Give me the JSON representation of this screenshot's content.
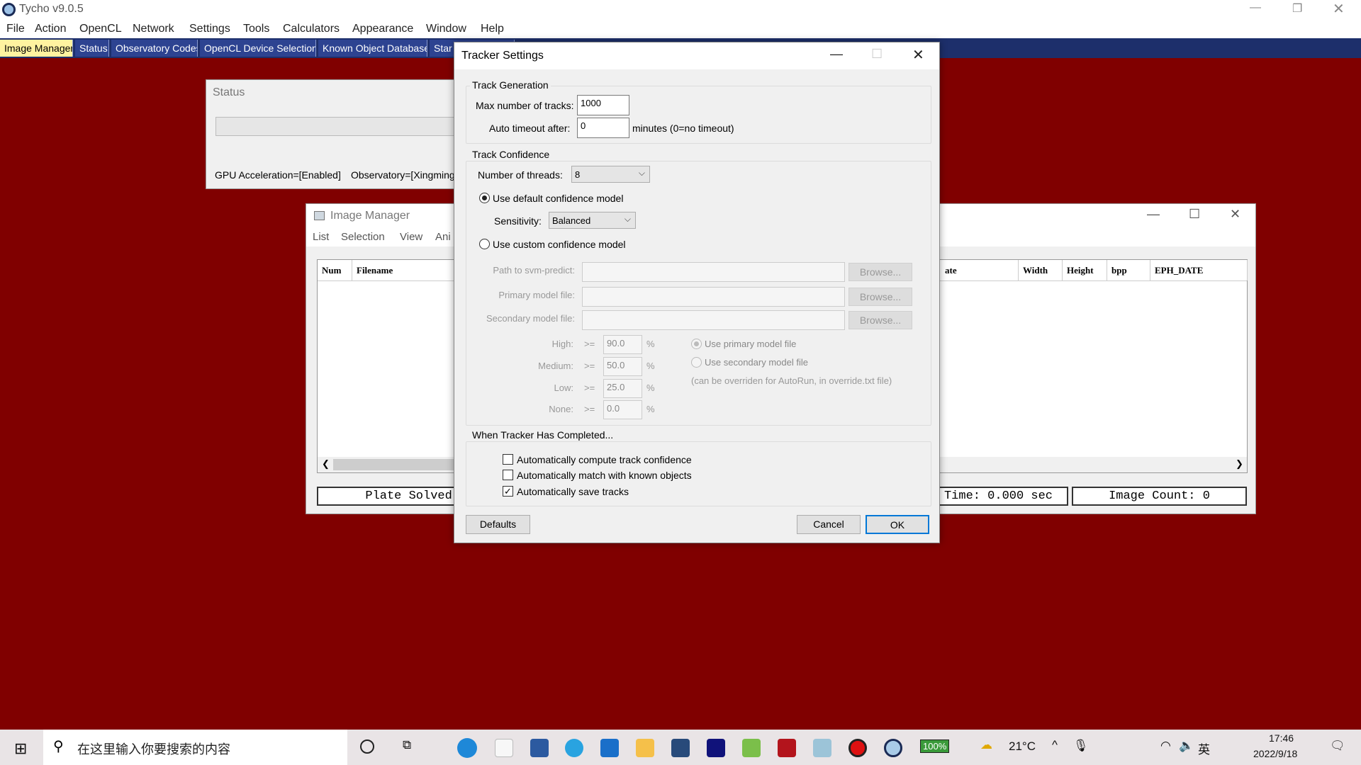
{
  "app": {
    "title": "Tycho v9.0.5"
  },
  "menu": [
    "File",
    "Action",
    "OpenCL",
    "Network",
    "Settings",
    "Tools",
    "Calculators",
    "Appearance",
    "Window",
    "Help"
  ],
  "tabs": [
    {
      "label": "Image Manager",
      "active": true
    },
    {
      "label": "Status"
    },
    {
      "label": "Observatory Codes"
    },
    {
      "label": "OpenCL Device Selection"
    },
    {
      "label": "Known Object Database"
    },
    {
      "label": "Star"
    }
  ],
  "colors": {
    "background": "#800000",
    "tab_active": "#fff3a0",
    "tab_bar": "#1d2f6b",
    "ok_border": "#0078d7"
  },
  "status_window": {
    "title": "Status",
    "gpu": "GPU Acceleration=[Enabled]",
    "observatory": "Observatory=[Xingming"
  },
  "image_manager": {
    "title": "Image Manager",
    "menu": [
      "List",
      "Selection",
      "View",
      "Ani"
    ],
    "columns_left": [
      "Num",
      "Filename"
    ],
    "columns_right": [
      "ate",
      "Width",
      "Height",
      "bpp",
      "EPH_DATE"
    ],
    "plate_solved": "Plate Solved: No",
    "time": "Time: 0.000 sec",
    "image_count": "Image Count: 0"
  },
  "dialog": {
    "title": "Tracker Settings",
    "track_generation": {
      "label": "Track Generation",
      "max_tracks_label": "Max number of tracks:",
      "max_tracks": "1000",
      "timeout_label": "Auto timeout after:",
      "timeout": "0",
      "timeout_unit": "minutes (0=no timeout)"
    },
    "track_confidence": {
      "label": "Track Confidence",
      "threads_label": "Number of threads:",
      "threads": "8",
      "default_model": "Use default confidence model",
      "default_selected": true,
      "sensitivity_label": "Sensitivity:",
      "sensitivity": "Balanced",
      "custom_model": "Use custom confidence model",
      "svm_label": "Path to svm-predict:",
      "primary_label": "Primary model file:",
      "secondary_label": "Secondary model file:",
      "browse": "Browse...",
      "ge": ">=",
      "pct": "%",
      "thresholds": [
        {
          "label": "High:",
          "value": "90.0"
        },
        {
          "label": "Medium:",
          "value": "50.0"
        },
        {
          "label": "Low:",
          "value": "25.0"
        },
        {
          "label": "None:",
          "value": "0.0"
        }
      ],
      "use_primary": "Use primary model file",
      "use_secondary": "Use secondary model file",
      "note": "(can be overriden for AutoRun, in override.txt file)"
    },
    "completed": {
      "label": "When Tracker Has Completed...",
      "options": [
        {
          "label": "Automatically compute track confidence",
          "checked": false
        },
        {
          "label": "Automatically match with known objects",
          "checked": false
        },
        {
          "label": "Automatically save tracks",
          "checked": true
        }
      ]
    },
    "defaults": "Defaults",
    "cancel": "Cancel",
    "ok": "OK"
  },
  "taskbar": {
    "search_placeholder": "在这里输入你要搜索的内容",
    "battery": "100%",
    "weather": "21°C",
    "ime": "英",
    "time": "17:46",
    "date": "2022/9/18"
  }
}
